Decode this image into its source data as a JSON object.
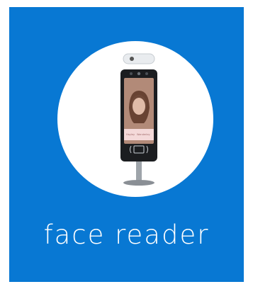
{
  "card": {
    "title": "face reader",
    "background_color": "#0878d3"
  },
  "device_screen": {
    "left_name": "Hayley",
    "right_name": "Wanderley"
  },
  "icons": {
    "nfc": "nfc-icon",
    "thermal": "thermal-camera-icon"
  }
}
